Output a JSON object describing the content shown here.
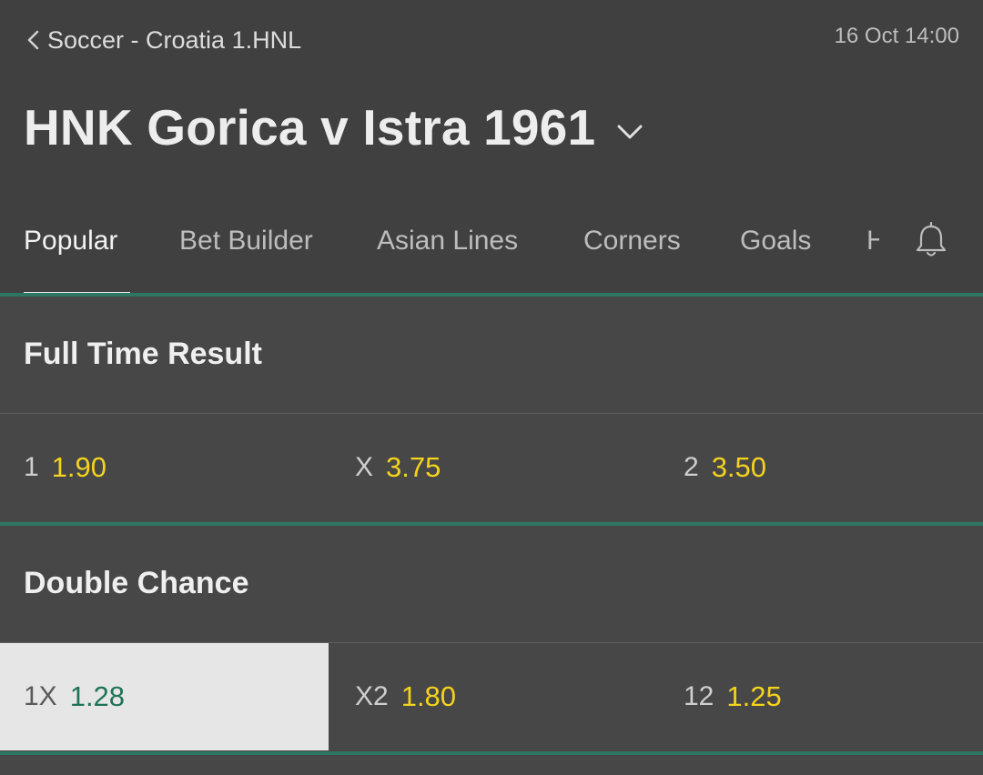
{
  "header": {
    "breadcrumb": "Soccer - Croatia 1.HNL",
    "datetime": "16 Oct 14:00",
    "title": "HNK Gorica v Istra 1961"
  },
  "tabs": [
    {
      "label": "Popular",
      "active": true
    },
    {
      "label": "Bet Builder",
      "active": false
    },
    {
      "label": "Asian Lines",
      "active": false
    },
    {
      "label": "Corners",
      "active": false
    },
    {
      "label": "Goals",
      "active": false
    },
    {
      "label": "H",
      "active": false
    }
  ],
  "icons": {
    "back": "chevron-left-icon",
    "title_dropdown": "chevron-down-icon",
    "notifications": "bell-icon"
  },
  "colors": {
    "accent_green": "#2f7661",
    "odds_yellow": "#f4d31d",
    "selected_odds_green": "#1f7456"
  },
  "markets": [
    {
      "title": "Full Time Result",
      "odds": [
        {
          "label": "1",
          "value": "1.90",
          "selected": false
        },
        {
          "label": "X",
          "value": "3.75",
          "selected": false
        },
        {
          "label": "2",
          "value": "3.50",
          "selected": false
        }
      ]
    },
    {
      "title": "Double Chance",
      "odds": [
        {
          "label": "1X",
          "value": "1.28",
          "selected": true
        },
        {
          "label": "X2",
          "value": "1.80",
          "selected": false
        },
        {
          "label": "12",
          "value": "1.25",
          "selected": false
        }
      ]
    }
  ]
}
